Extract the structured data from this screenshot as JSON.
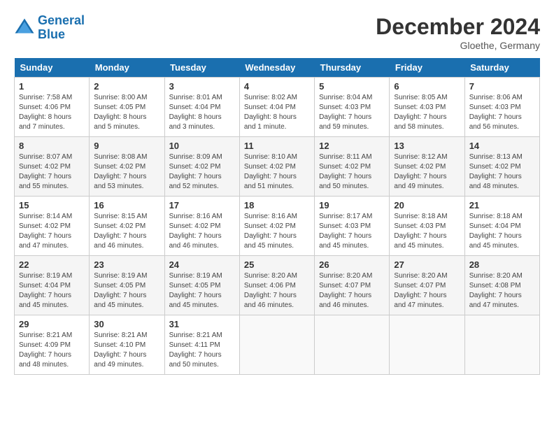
{
  "header": {
    "logo_line1": "General",
    "logo_line2": "Blue",
    "month_title": "December 2024",
    "subtitle": "Gloethe, Germany"
  },
  "days_of_week": [
    "Sunday",
    "Monday",
    "Tuesday",
    "Wednesday",
    "Thursday",
    "Friday",
    "Saturday"
  ],
  "weeks": [
    [
      {
        "day": 1,
        "info": "Sunrise: 7:58 AM\nSunset: 4:06 PM\nDaylight: 8 hours\nand 7 minutes."
      },
      {
        "day": 2,
        "info": "Sunrise: 8:00 AM\nSunset: 4:05 PM\nDaylight: 8 hours\nand 5 minutes."
      },
      {
        "day": 3,
        "info": "Sunrise: 8:01 AM\nSunset: 4:04 PM\nDaylight: 8 hours\nand 3 minutes."
      },
      {
        "day": 4,
        "info": "Sunrise: 8:02 AM\nSunset: 4:04 PM\nDaylight: 8 hours\nand 1 minute."
      },
      {
        "day": 5,
        "info": "Sunrise: 8:04 AM\nSunset: 4:03 PM\nDaylight: 7 hours\nand 59 minutes."
      },
      {
        "day": 6,
        "info": "Sunrise: 8:05 AM\nSunset: 4:03 PM\nDaylight: 7 hours\nand 58 minutes."
      },
      {
        "day": 7,
        "info": "Sunrise: 8:06 AM\nSunset: 4:03 PM\nDaylight: 7 hours\nand 56 minutes."
      }
    ],
    [
      {
        "day": 8,
        "info": "Sunrise: 8:07 AM\nSunset: 4:02 PM\nDaylight: 7 hours\nand 55 minutes."
      },
      {
        "day": 9,
        "info": "Sunrise: 8:08 AM\nSunset: 4:02 PM\nDaylight: 7 hours\nand 53 minutes."
      },
      {
        "day": 10,
        "info": "Sunrise: 8:09 AM\nSunset: 4:02 PM\nDaylight: 7 hours\nand 52 minutes."
      },
      {
        "day": 11,
        "info": "Sunrise: 8:10 AM\nSunset: 4:02 PM\nDaylight: 7 hours\nand 51 minutes."
      },
      {
        "day": 12,
        "info": "Sunrise: 8:11 AM\nSunset: 4:02 PM\nDaylight: 7 hours\nand 50 minutes."
      },
      {
        "day": 13,
        "info": "Sunrise: 8:12 AM\nSunset: 4:02 PM\nDaylight: 7 hours\nand 49 minutes."
      },
      {
        "day": 14,
        "info": "Sunrise: 8:13 AM\nSunset: 4:02 PM\nDaylight: 7 hours\nand 48 minutes."
      }
    ],
    [
      {
        "day": 15,
        "info": "Sunrise: 8:14 AM\nSunset: 4:02 PM\nDaylight: 7 hours\nand 47 minutes."
      },
      {
        "day": 16,
        "info": "Sunrise: 8:15 AM\nSunset: 4:02 PM\nDaylight: 7 hours\nand 46 minutes."
      },
      {
        "day": 17,
        "info": "Sunrise: 8:16 AM\nSunset: 4:02 PM\nDaylight: 7 hours\nand 46 minutes."
      },
      {
        "day": 18,
        "info": "Sunrise: 8:16 AM\nSunset: 4:02 PM\nDaylight: 7 hours\nand 45 minutes."
      },
      {
        "day": 19,
        "info": "Sunrise: 8:17 AM\nSunset: 4:03 PM\nDaylight: 7 hours\nand 45 minutes."
      },
      {
        "day": 20,
        "info": "Sunrise: 8:18 AM\nSunset: 4:03 PM\nDaylight: 7 hours\nand 45 minutes."
      },
      {
        "day": 21,
        "info": "Sunrise: 8:18 AM\nSunset: 4:04 PM\nDaylight: 7 hours\nand 45 minutes."
      }
    ],
    [
      {
        "day": 22,
        "info": "Sunrise: 8:19 AM\nSunset: 4:04 PM\nDaylight: 7 hours\nand 45 minutes."
      },
      {
        "day": 23,
        "info": "Sunrise: 8:19 AM\nSunset: 4:05 PM\nDaylight: 7 hours\nand 45 minutes."
      },
      {
        "day": 24,
        "info": "Sunrise: 8:19 AM\nSunset: 4:05 PM\nDaylight: 7 hours\nand 45 minutes."
      },
      {
        "day": 25,
        "info": "Sunrise: 8:20 AM\nSunset: 4:06 PM\nDaylight: 7 hours\nand 46 minutes."
      },
      {
        "day": 26,
        "info": "Sunrise: 8:20 AM\nSunset: 4:07 PM\nDaylight: 7 hours\nand 46 minutes."
      },
      {
        "day": 27,
        "info": "Sunrise: 8:20 AM\nSunset: 4:07 PM\nDaylight: 7 hours\nand 47 minutes."
      },
      {
        "day": 28,
        "info": "Sunrise: 8:20 AM\nSunset: 4:08 PM\nDaylight: 7 hours\nand 47 minutes."
      }
    ],
    [
      {
        "day": 29,
        "info": "Sunrise: 8:21 AM\nSunset: 4:09 PM\nDaylight: 7 hours\nand 48 minutes."
      },
      {
        "day": 30,
        "info": "Sunrise: 8:21 AM\nSunset: 4:10 PM\nDaylight: 7 hours\nand 49 minutes."
      },
      {
        "day": 31,
        "info": "Sunrise: 8:21 AM\nSunset: 4:11 PM\nDaylight: 7 hours\nand 50 minutes."
      },
      null,
      null,
      null,
      null
    ]
  ]
}
